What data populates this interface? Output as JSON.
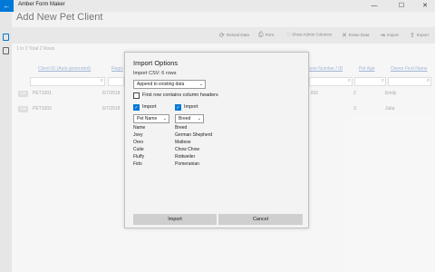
{
  "window": {
    "back_icon": "←",
    "title": "Amber Form Maker",
    "minimize": "—",
    "maximize": "☐",
    "close": "✕"
  },
  "page": {
    "title": "Add New Pet Client",
    "row_count": "1 to 2 Total 2 Rows"
  },
  "toolbar": [
    {
      "icon": "⟳",
      "label": "Reload Data"
    },
    {
      "icon": "⎙",
      "label": "Print"
    },
    {
      "icon": "◌",
      "label": "Show Admin Columns"
    },
    {
      "icon": "✕",
      "label": "Erase Data"
    },
    {
      "icon": "⇥",
      "label": "Import"
    },
    {
      "icon": "⇪",
      "label": "Export"
    }
  ],
  "grid": {
    "headers": [
      "Client ID (Auto generated)",
      "Regis",
      "phone Number / ID",
      "Pet Age",
      "Owner First Name"
    ],
    "edit_label": "Edit",
    "rows": [
      {
        "id": "PET1001",
        "date": "6/7/2018",
        "phone": "831",
        "age": "2",
        "owner": "Emily"
      },
      {
        "id": "PET1002",
        "date": "6/7/2018",
        "phone": "",
        "age": "3",
        "owner": "Julia"
      }
    ]
  },
  "dialog": {
    "title": "Import Options",
    "subtitle": "Import CSV: 6 rows",
    "mode_selected": "Append to existing data",
    "first_row_header_label": "First row contains column headers",
    "import_label": "Import",
    "col1_field": "Pet Name",
    "col2_field": "Breed",
    "col1_values": [
      "Name",
      "Joey",
      "Oreo",
      "Cutie",
      "Fluffy",
      "Fido"
    ],
    "col2_values": [
      "Breed",
      "German Shepherd",
      "Maltese",
      "Chow Chow",
      "Rottweiler",
      "Pomeranian"
    ],
    "import_button": "Import",
    "cancel_button": "Cancel"
  }
}
